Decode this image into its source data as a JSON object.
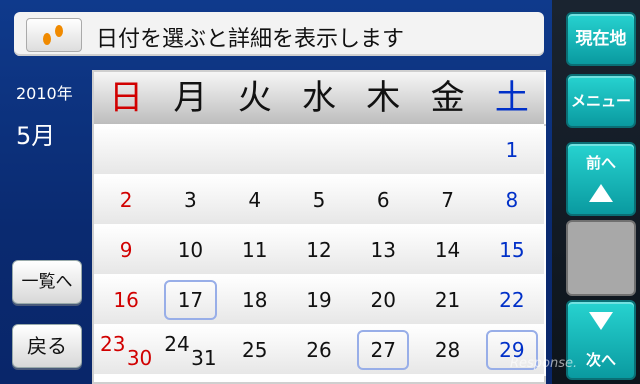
{
  "hint": {
    "text": "日付を選ぶと詳細を表示します",
    "icon": "footprints-icon"
  },
  "date": {
    "year": "2010年",
    "month": "5月"
  },
  "buttons": {
    "list": "一覧へ",
    "back": "戻る",
    "now": "現在地",
    "menu": "メニュー",
    "prev": "前へ",
    "next": "次へ"
  },
  "weekdays": [
    "日",
    "月",
    "火",
    "水",
    "木",
    "金",
    "土"
  ],
  "weeks": [
    [
      "",
      "",
      "",
      "",
      "",
      "",
      "1"
    ],
    [
      "2",
      "3",
      "4",
      "5",
      "6",
      "7",
      "8"
    ],
    [
      "9",
      "10",
      "11",
      "12",
      "13",
      "14",
      "15"
    ],
    [
      "16",
      "17",
      "18",
      "19",
      "20",
      "21",
      "22"
    ],
    [
      "23/30",
      "24/31",
      "25",
      "26",
      "27",
      "28",
      "29"
    ]
  ],
  "selected_days": [
    "17",
    "27",
    "29"
  ],
  "watermark": "Response."
}
